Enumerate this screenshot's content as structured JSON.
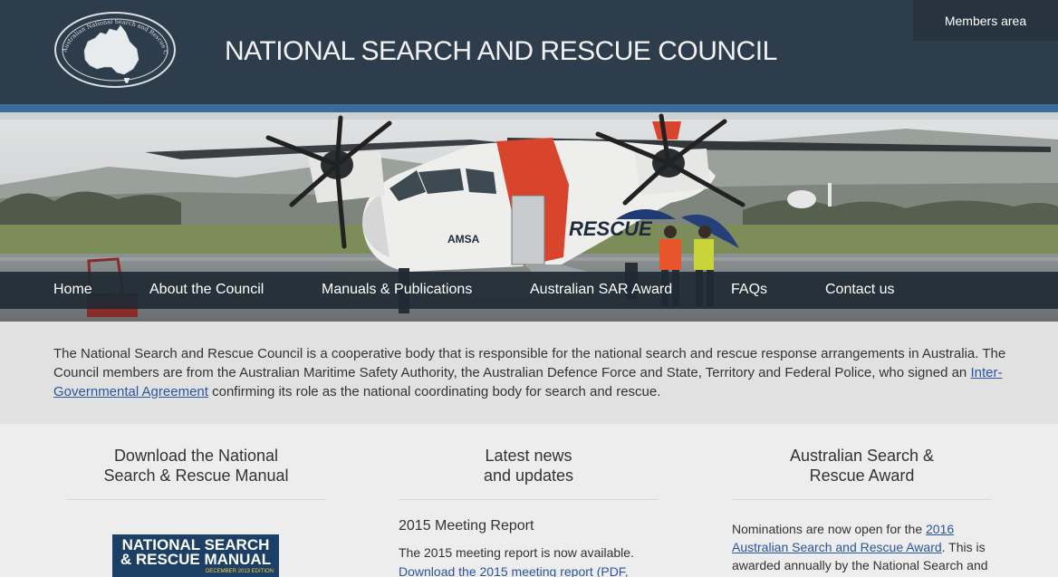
{
  "header": {
    "title": "NATIONAL SEARCH AND RESCUE COUNCIL",
    "logo_text": "Australian National Search and Rescue Council",
    "members_label": "Members area"
  },
  "nav": {
    "items": [
      {
        "label": "Home"
      },
      {
        "label": "About the Council"
      },
      {
        "label": "Manuals & Publications"
      },
      {
        "label": "Australian SAR Award"
      },
      {
        "label": "FAQs"
      },
      {
        "label": "Contact us"
      }
    ]
  },
  "hero": {
    "plane_text": "RESCUE",
    "plane_logo": "AMSA"
  },
  "intro": {
    "text_before": "The National Search and Rescue Council is a cooperative body that is responsible for the national search and rescue response arrangements in Australia. The Council members are from the Australian Maritime Safety Authority, the Australian Defence Force and State, Territory and Federal Police, who signed an ",
    "link": "Inter-Governmental Agreement",
    "text_after": " confirming its role as the national coordinating body for search and rescue."
  },
  "columns": {
    "manual": {
      "heading": "Download the National\nSearch & Rescue Manual",
      "cover_line1": "NATIONAL SEARCH",
      "cover_line2": "& RESCUE MANUAL",
      "cover_edition": "DECEMBER 2013 EDITION"
    },
    "news": {
      "heading": "Latest news\nand updates",
      "item_title": "2015 Meeting Report",
      "item_text": "The 2015 meeting report is now available.",
      "item_link": "Download the 2015 meeting report (PDF,"
    },
    "award": {
      "heading": "Australian Search &\nRescue Award",
      "text_before": "Nominations are now open for the ",
      "link": "2016 Australian Search and Rescue Award",
      "text_after": ".  This is awarded annually by the National Search and"
    }
  },
  "colors": {
    "header_bg": "#2e3d4b",
    "accent_stripe": "#3a6d9c",
    "link": "#2a55a3"
  }
}
